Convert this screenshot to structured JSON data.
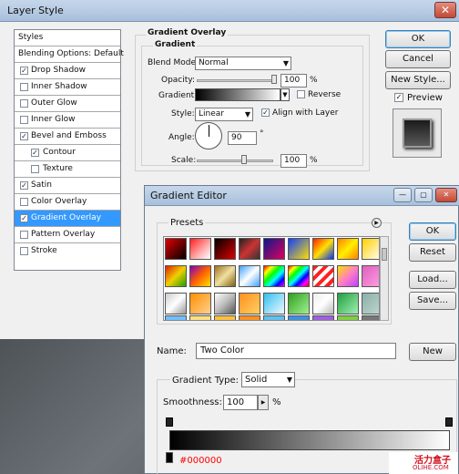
{
  "layer_style": {
    "title": "Layer Style",
    "panel_items": [
      {
        "label": "Styles",
        "checked": null
      },
      {
        "label": "Blending Options: Default",
        "checked": null
      },
      {
        "label": "Drop Shadow",
        "checked": true
      },
      {
        "label": "Inner Shadow",
        "checked": false
      },
      {
        "label": "Outer Glow",
        "checked": false
      },
      {
        "label": "Inner Glow",
        "checked": false
      },
      {
        "label": "Bevel and Emboss",
        "checked": true
      },
      {
        "label": "Contour",
        "checked": true
      },
      {
        "label": "Texture",
        "checked": false
      },
      {
        "label": "Satin",
        "checked": true
      },
      {
        "label": "Color Overlay",
        "checked": false
      },
      {
        "label": "Gradient Overlay",
        "checked": true
      },
      {
        "label": "Pattern Overlay",
        "checked": false
      },
      {
        "label": "Stroke",
        "checked": false
      }
    ],
    "section_title": "Gradient Overlay",
    "subsection_title": "Gradient",
    "blend_mode_label": "Blend Mode:",
    "blend_mode_value": "Normal",
    "opacity_label": "Opacity:",
    "opacity_value": "100",
    "percent": "%",
    "gradient_label": "Gradient:",
    "reverse_label": "Reverse",
    "style_label": "Style:",
    "style_value": "Linear",
    "align_label": "Align with Layer",
    "angle_label": "Angle:",
    "angle_value": "90",
    "degree": "°",
    "scale_label": "Scale:",
    "scale_value": "100",
    "ok": "OK",
    "cancel": "Cancel",
    "new_style": "New Style...",
    "preview": "Preview"
  },
  "gradient_editor": {
    "title": "Gradient Editor",
    "presets_label": "Presets",
    "ok": "OK",
    "reset": "Reset",
    "load": "Load...",
    "save": "Save...",
    "name_label": "Name:",
    "name_value": "Two Color",
    "new": "New",
    "gradient_type_label": "Gradient Type:",
    "gradient_type_value": "Solid",
    "smoothness_label": "Smoothness:",
    "smoothness_value": "100",
    "percent": "%",
    "stop_color": "#000000",
    "watermark_1": "活力盒子",
    "watermark_2": "OLIHE.COM"
  },
  "colors": {
    "selected": "#3399ff",
    "stop_color_text": "#ff0000"
  }
}
